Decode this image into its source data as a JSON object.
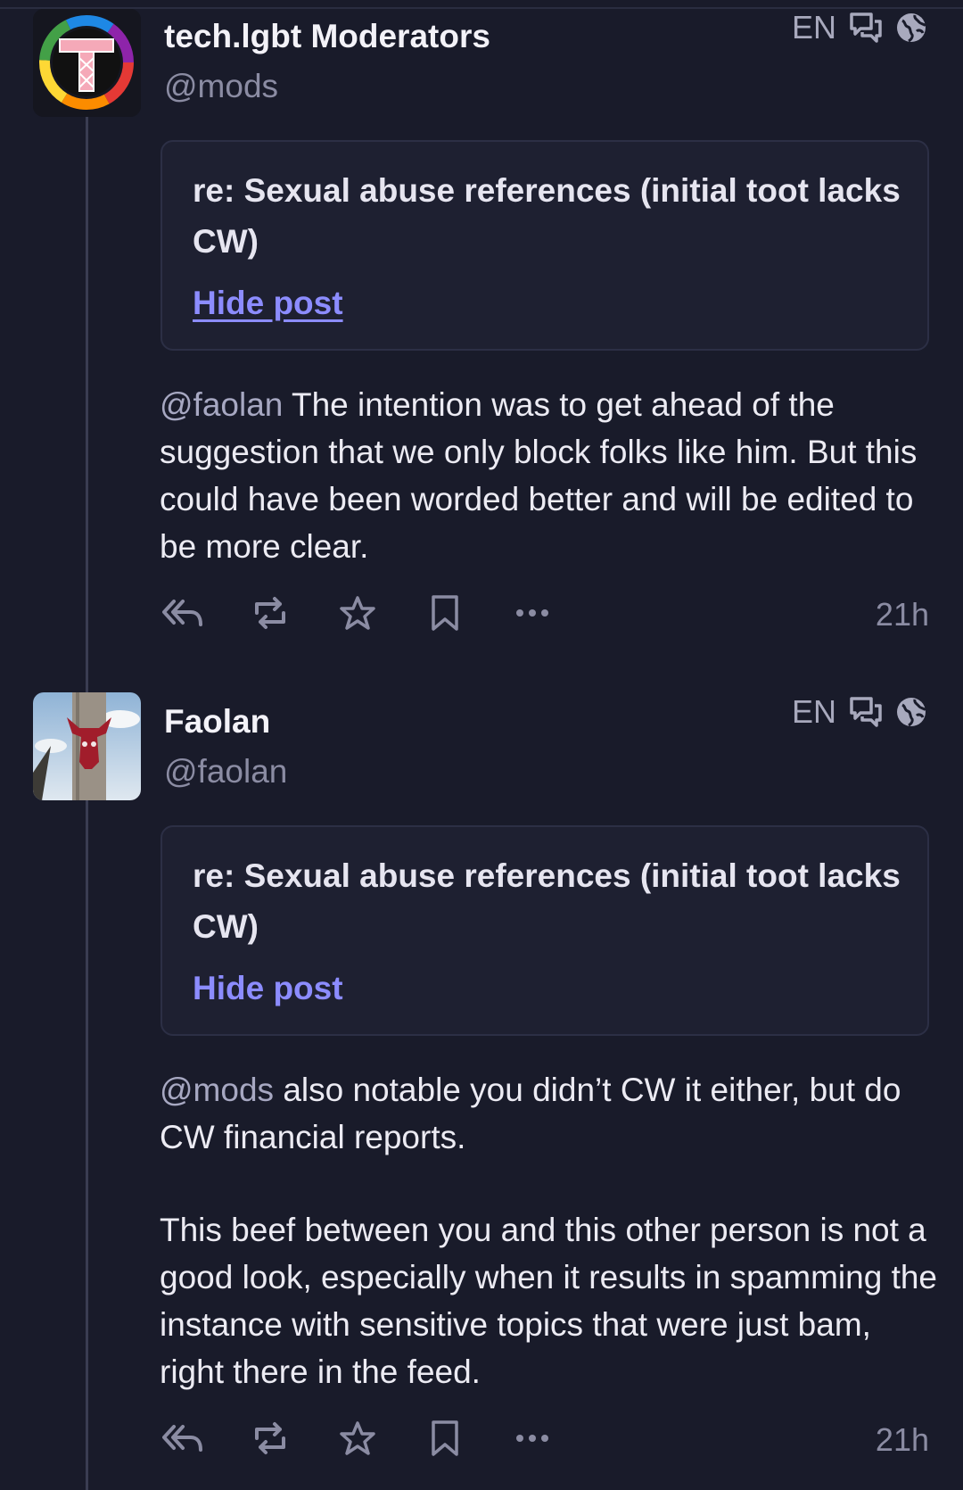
{
  "posts": [
    {
      "display_name": "tech.lgbt Moderators",
      "handle": "@mods",
      "language": "EN",
      "content_warning": "re: Sexual abuse references (initial toot lacks CW)",
      "toggle_label": "Hide post",
      "mention": "@mods",
      "paragraphs": [
        {
          "mention": "@faolan",
          "text": " The intention was to get ahead of the suggestion that we only block folks like him. But this could have been worded better and will be edited to be more clear."
        }
      ],
      "time": "21h",
      "icons": [
        "reply-all-icon",
        "boost-icon",
        "star-icon",
        "bookmark-icon",
        "more-icon"
      ]
    },
    {
      "display_name": "Faolan",
      "handle": "@faolan",
      "language": "EN",
      "content_warning": "re: Sexual abuse references (initial toot lacks CW)",
      "toggle_label": "Hide post",
      "paragraphs": [
        {
          "mention": "@mods",
          "text": " also notable you didn’t CW it either, but do CW financial reports."
        },
        {
          "mention": "",
          "text": "This beef between you and this other person is not a good look, especially when it results in spamming the instance with sensitive topics that were just bam, right there in the feed."
        }
      ],
      "time": "21h",
      "icons": [
        "reply-all-icon",
        "boost-icon",
        "star-icon",
        "bookmark-icon",
        "more-icon"
      ]
    }
  ],
  "colors": {
    "background": "#191b2a",
    "link": "#8c8cff",
    "muted": "#8b8ca3"
  }
}
